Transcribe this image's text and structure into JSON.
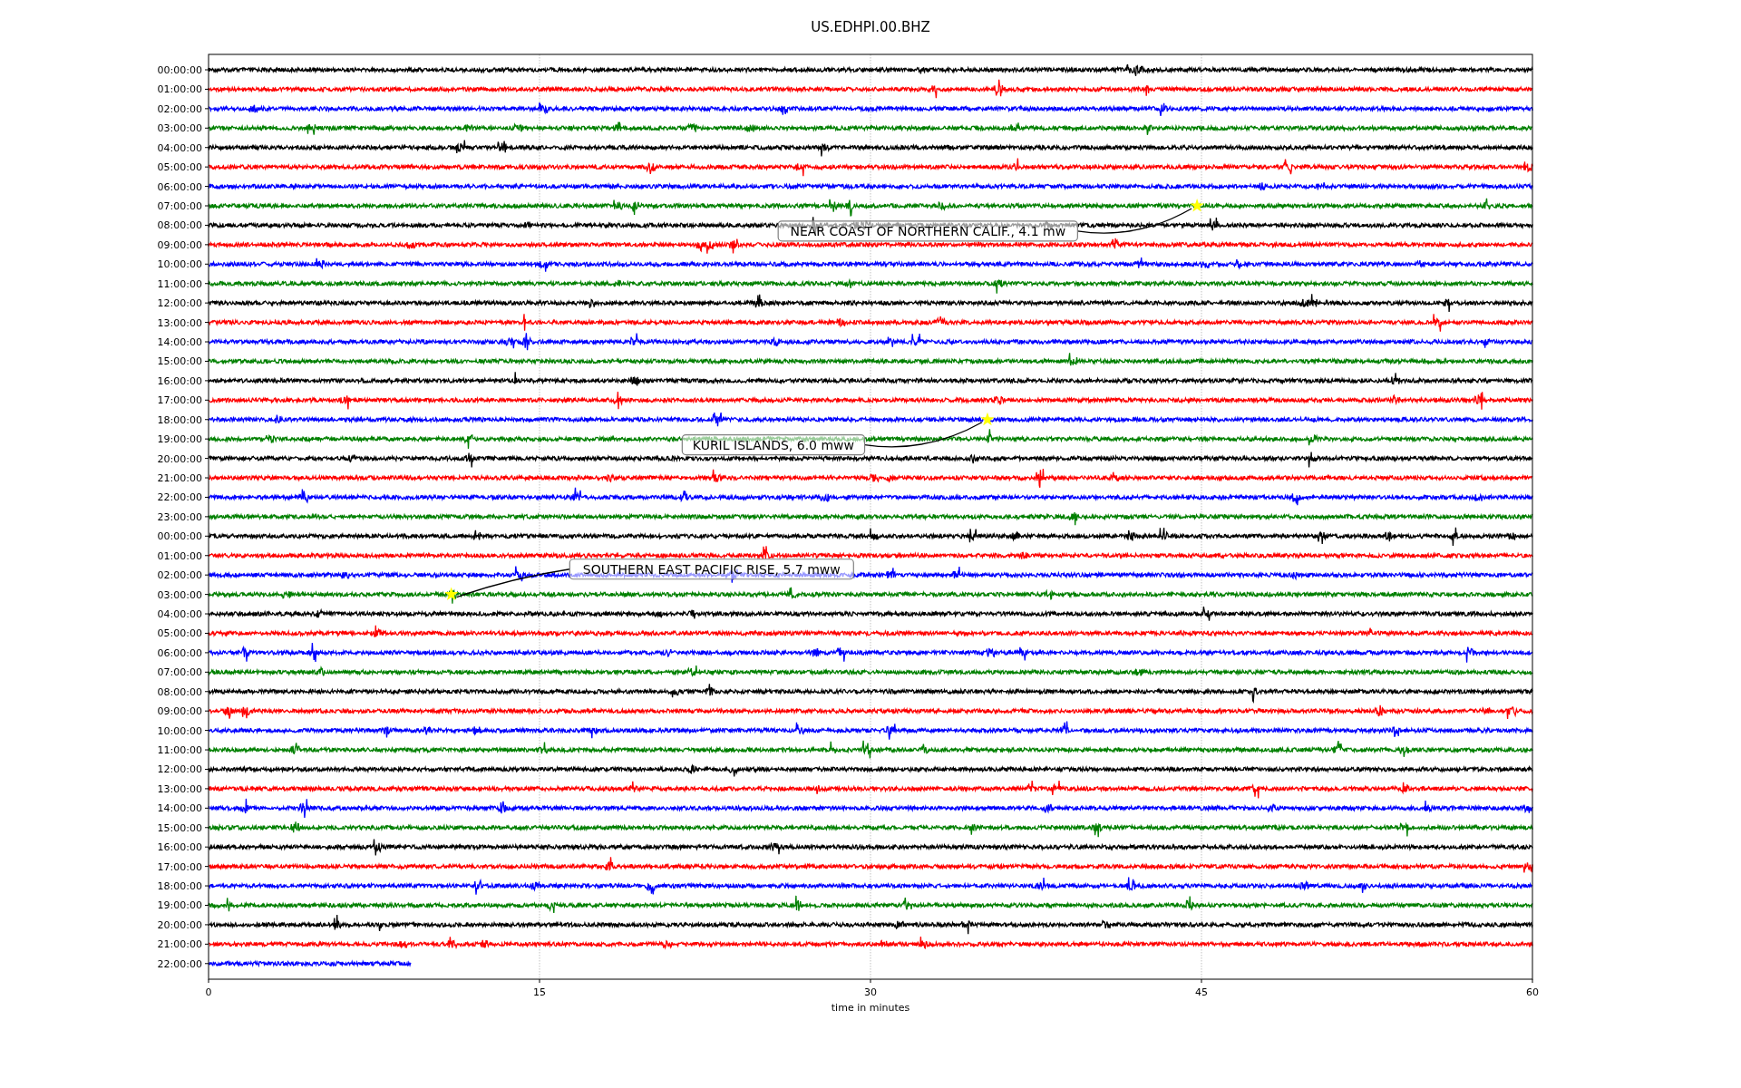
{
  "plot": {
    "title": "US.EDHPI.00.BHZ",
    "xlabel": "time in minutes",
    "xticks": [
      "0",
      "15",
      "30",
      "45",
      "60"
    ],
    "rows": [
      {
        "label": "00:00:00",
        "color": "#000000",
        "complete": true
      },
      {
        "label": "01:00:00",
        "color": "#ff0000",
        "complete": true
      },
      {
        "label": "02:00:00",
        "color": "#0000ff",
        "complete": true
      },
      {
        "label": "03:00:00",
        "color": "#008000",
        "complete": true
      },
      {
        "label": "04:00:00",
        "color": "#000000",
        "complete": true
      },
      {
        "label": "05:00:00",
        "color": "#ff0000",
        "complete": true
      },
      {
        "label": "06:00:00",
        "color": "#0000ff",
        "complete": true
      },
      {
        "label": "07:00:00",
        "color": "#008000",
        "complete": true,
        "event": "NEAR COAST OF NORTHERN CALIF., 4.1 mw"
      },
      {
        "label": "08:00:00",
        "color": "#000000",
        "complete": true
      },
      {
        "label": "09:00:00",
        "color": "#ff0000",
        "complete": true
      },
      {
        "label": "10:00:00",
        "color": "#0000ff",
        "complete": true
      },
      {
        "label": "11:00:00",
        "color": "#008000",
        "complete": true
      },
      {
        "label": "12:00:00",
        "color": "#000000",
        "complete": true
      },
      {
        "label": "13:00:00",
        "color": "#ff0000",
        "complete": true
      },
      {
        "label": "14:00:00",
        "color": "#0000ff",
        "complete": true
      },
      {
        "label": "15:00:00",
        "color": "#008000",
        "complete": true
      },
      {
        "label": "16:00:00",
        "color": "#000000",
        "complete": true
      },
      {
        "label": "17:00:00",
        "color": "#ff0000",
        "complete": true
      },
      {
        "label": "18:00:00",
        "color": "#0000ff",
        "complete": true,
        "event": "KURIL ISLANDS, 6.0 mww"
      },
      {
        "label": "19:00:00",
        "color": "#008000",
        "complete": true
      },
      {
        "label": "20:00:00",
        "color": "#000000",
        "complete": true
      },
      {
        "label": "21:00:00",
        "color": "#ff0000",
        "complete": true
      },
      {
        "label": "22:00:00",
        "color": "#0000ff",
        "complete": true
      },
      {
        "label": "23:00:00",
        "color": "#008000",
        "complete": true
      },
      {
        "label": "00:00:00",
        "color": "#000000",
        "complete": true
      },
      {
        "label": "01:00:00",
        "color": "#ff0000",
        "complete": true
      },
      {
        "label": "02:00:00",
        "color": "#0000ff",
        "complete": true
      },
      {
        "label": "03:00:00",
        "color": "#008000",
        "complete": true,
        "event": "SOUTHERN EAST PACIFIC RISE, 5.7 mww"
      },
      {
        "label": "04:00:00",
        "color": "#000000",
        "complete": true
      },
      {
        "label": "05:00:00",
        "color": "#ff0000",
        "complete": true
      },
      {
        "label": "06:00:00",
        "color": "#0000ff",
        "complete": true
      },
      {
        "label": "07:00:00",
        "color": "#008000",
        "complete": true
      },
      {
        "label": "08:00:00",
        "color": "#000000",
        "complete": true
      },
      {
        "label": "09:00:00",
        "color": "#ff0000",
        "complete": true
      },
      {
        "label": "10:00:00",
        "color": "#0000ff",
        "complete": true
      },
      {
        "label": "11:00:00",
        "color": "#008000",
        "complete": true
      },
      {
        "label": "12:00:00",
        "color": "#000000",
        "complete": true
      },
      {
        "label": "13:00:00",
        "color": "#ff0000",
        "complete": true
      },
      {
        "label": "14:00:00",
        "color": "#0000ff",
        "complete": true
      },
      {
        "label": "15:00:00",
        "color": "#008000",
        "complete": true
      },
      {
        "label": "16:00:00",
        "color": "#000000",
        "complete": true
      },
      {
        "label": "17:00:00",
        "color": "#ff0000",
        "complete": true
      },
      {
        "label": "18:00:00",
        "color": "#0000ff",
        "complete": true
      },
      {
        "label": "19:00:00",
        "color": "#008000",
        "complete": true
      },
      {
        "label": "20:00:00",
        "color": "#000000",
        "complete": true
      },
      {
        "label": "21:00:00",
        "color": "#ff0000",
        "complete": true
      },
      {
        "label": "22:00:00",
        "color": "#0000ff",
        "complete": false
      }
    ]
  }
}
